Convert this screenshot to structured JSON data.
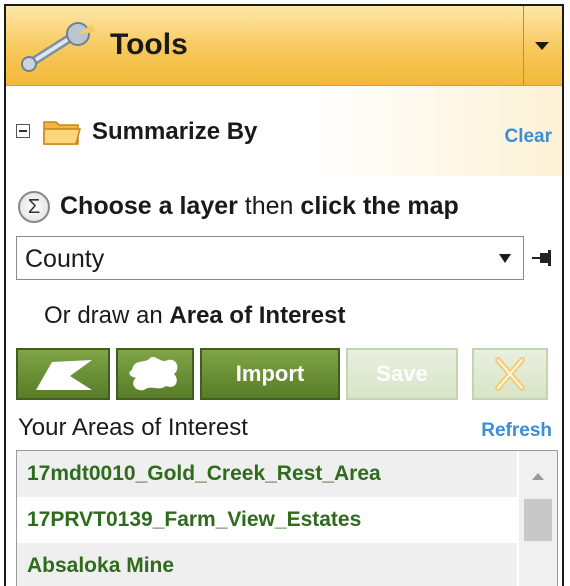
{
  "panel": {
    "title": "Tools"
  },
  "summarize": {
    "label": "Summarize By",
    "clear_label": "Clear",
    "instruction_part1": "Choose a layer",
    "instruction_part2": " then ",
    "instruction_part3": "click the map",
    "layer_select_value": "County"
  },
  "draw": {
    "prefix": "Or draw an ",
    "bold": "Area of Interest",
    "import_label": "Import",
    "save_label": "Save"
  },
  "aoi": {
    "label": "Your Areas of Interest",
    "refresh_label": "Refresh",
    "items": [
      "17mdt0010_Gold_Creek_Rest_Area",
      "17PRVT0139_Farm_View_Estates",
      "Absaloka Mine"
    ]
  },
  "colors": {
    "accent_link": "#3b8ed6",
    "button_green": "#577c27",
    "list_text_green": "#2f6b1d",
    "header_orange": "#f2b93a"
  }
}
